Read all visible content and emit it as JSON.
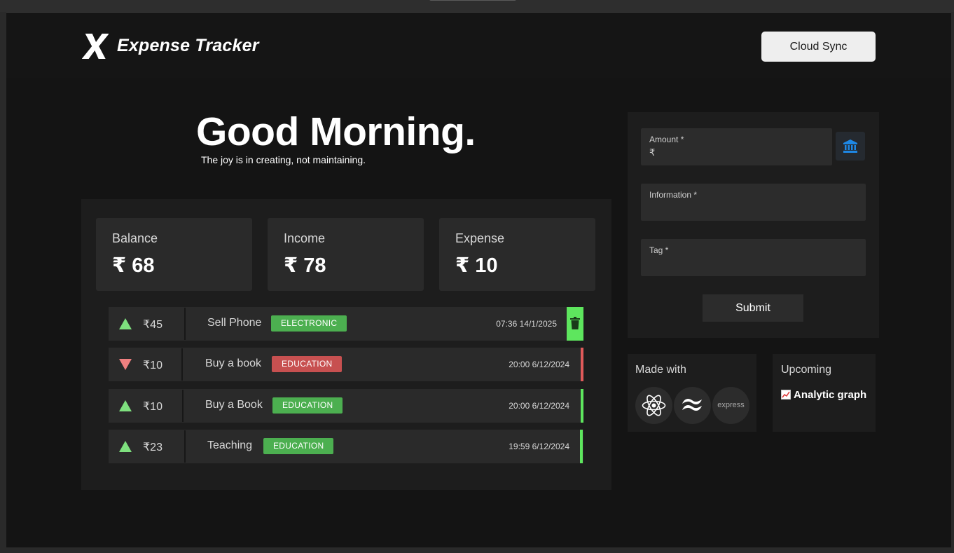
{
  "app": {
    "brand": "Expense Tracker",
    "cloud_sync_label": "Cloud Sync"
  },
  "hero": {
    "greeting": "Good Morning.",
    "subline": "The joy is in creating, not maintaining."
  },
  "summary": {
    "balance": {
      "label": "Balance",
      "value": "₹ 68"
    },
    "income": {
      "label": "Income",
      "value": "₹ 78"
    },
    "expense": {
      "label": "Expense",
      "value": "₹ 10"
    }
  },
  "transactions": [
    {
      "direction": "up",
      "amount": "₹45",
      "info": "Sell Phone",
      "tag": "ELECTRONIC",
      "tag_color": "#4caf50",
      "datetime": "07:36 14/1/2025",
      "bar_color": "#5ee65e",
      "has_delete": true
    },
    {
      "direction": "down",
      "amount": "₹10",
      "info": "Buy a book",
      "tag": "EDUCATION",
      "tag_color": "#c75050",
      "datetime": "20:00 6/12/2024",
      "bar_color": "#e05a5a",
      "has_delete": false
    },
    {
      "direction": "up",
      "amount": "₹10",
      "info": "Buy a Book",
      "tag": "EDUCATION",
      "tag_color": "#4caf50",
      "datetime": "20:00 6/12/2024",
      "bar_color": "#5ee65e",
      "has_delete": false
    },
    {
      "direction": "up",
      "amount": "₹23",
      "info": "Teaching",
      "tag": "EDUCATION",
      "tag_color": "#4caf50",
      "datetime": "19:59 6/12/2024",
      "bar_color": "#5ee65e",
      "has_delete": false
    }
  ],
  "form": {
    "amount_label": "Amount *",
    "amount_value": "₹",
    "information_label": "Information *",
    "tag_label": "Tag *",
    "submit_label": "Submit"
  },
  "made_with": {
    "title": "Made with",
    "tech": [
      "react-icon",
      "tailwind-icon",
      "express"
    ]
  },
  "upcoming": {
    "title": "Upcoming",
    "item": "Analytic graph"
  },
  "colors": {
    "income_arrow": "#7ee07e",
    "expense_arrow": "#f08080",
    "bank_icon": "#1e88e5"
  }
}
